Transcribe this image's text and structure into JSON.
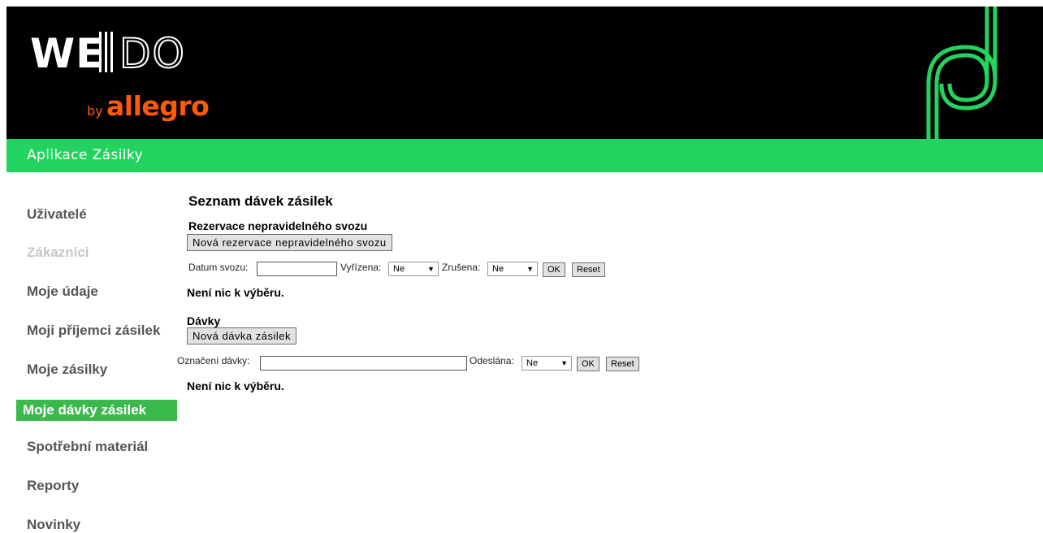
{
  "logo": {
    "we": "WE",
    "do": "DO",
    "by": "by",
    "allegro": "allegro"
  },
  "app_title": "Aplikace Zásilky",
  "sidebar": {
    "items": [
      {
        "label": "Uživatelé"
      },
      {
        "label": "Zákazníci"
      },
      {
        "label": "Moje údaje"
      },
      {
        "label": "Moji příjemci zásilek"
      },
      {
        "label": "Moje zásilky"
      },
      {
        "label": "Moje dávky zásilek"
      },
      {
        "label": "Spotřební materiál"
      },
      {
        "label": "Reporty"
      },
      {
        "label": "Novinky"
      }
    ]
  },
  "main": {
    "title": "Seznam dávek zásilek",
    "reservations": {
      "heading": "Rezervace nepravidelného svozu",
      "new_button": "Nová rezervace nepravidelného svozu",
      "date_label": "Datum svozu:",
      "date_value": "",
      "handled_label": "Vyřízena:",
      "handled_value": "Ne",
      "cancelled_label": "Zrušena:",
      "cancelled_value": "Ne",
      "ok": "OK",
      "reset": "Reset",
      "empty": "Není nic k výběru."
    },
    "batches": {
      "heading": "Dávky",
      "new_button": "Nová dávka zásilek",
      "mark_label": "Označení dávky:",
      "mark_value": "",
      "sent_label": "Odeslána:",
      "sent_value": "Ne",
      "ok": "OK",
      "reset": "Reset",
      "empty": "Není nic k výběru."
    }
  },
  "colors": {
    "header_bg": "#000000",
    "brand_green": "#22d45f",
    "active_nav": "#3ab94d",
    "allegro_orange": "#ff5a00"
  },
  "icons": {
    "select_arrow": "triangle-down"
  }
}
